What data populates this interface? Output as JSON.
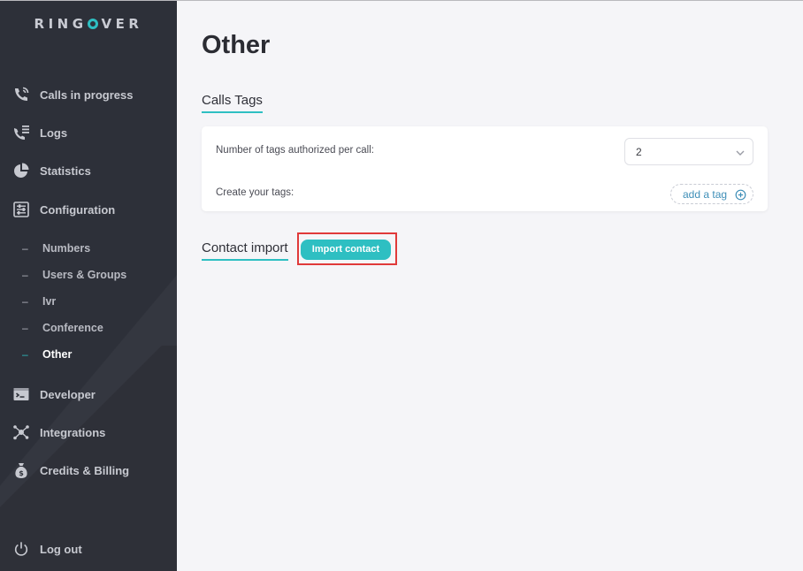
{
  "brand": {
    "logo_pre": "RING",
    "logo_post": "VER",
    "accent": "#2ebfc2"
  },
  "sidebar": {
    "items": [
      {
        "label": "Calls in progress",
        "icon": "phone-in-progress-icon"
      },
      {
        "label": "Logs",
        "icon": "call-log-icon"
      },
      {
        "label": "Statistics",
        "icon": "pie-chart-icon"
      },
      {
        "label": "Configuration",
        "icon": "sliders-icon"
      }
    ],
    "sub_items": [
      {
        "label": "Numbers",
        "active": false
      },
      {
        "label": "Users & Groups",
        "active": false
      },
      {
        "label": "Ivr",
        "active": false
      },
      {
        "label": "Conference",
        "active": false
      },
      {
        "label": "Other",
        "active": true
      }
    ],
    "items_bottom": [
      {
        "label": "Developer",
        "icon": "terminal-icon"
      },
      {
        "label": "Integrations",
        "icon": "network-icon"
      },
      {
        "label": "Credits & Billing",
        "icon": "money-bag-icon"
      }
    ],
    "logout": {
      "label": "Log out",
      "icon": "power-icon"
    },
    "dash": "–"
  },
  "main": {
    "title": "Other",
    "calls_tags": {
      "title": "Calls Tags",
      "tags_per_call_label": "Number of tags authorized per call:",
      "tags_per_call_value": "2",
      "create_tags_label": "Create your tags:",
      "add_tag_label": "add a tag"
    },
    "contact_import": {
      "title": "Contact import",
      "button_label": "Import contact"
    }
  }
}
